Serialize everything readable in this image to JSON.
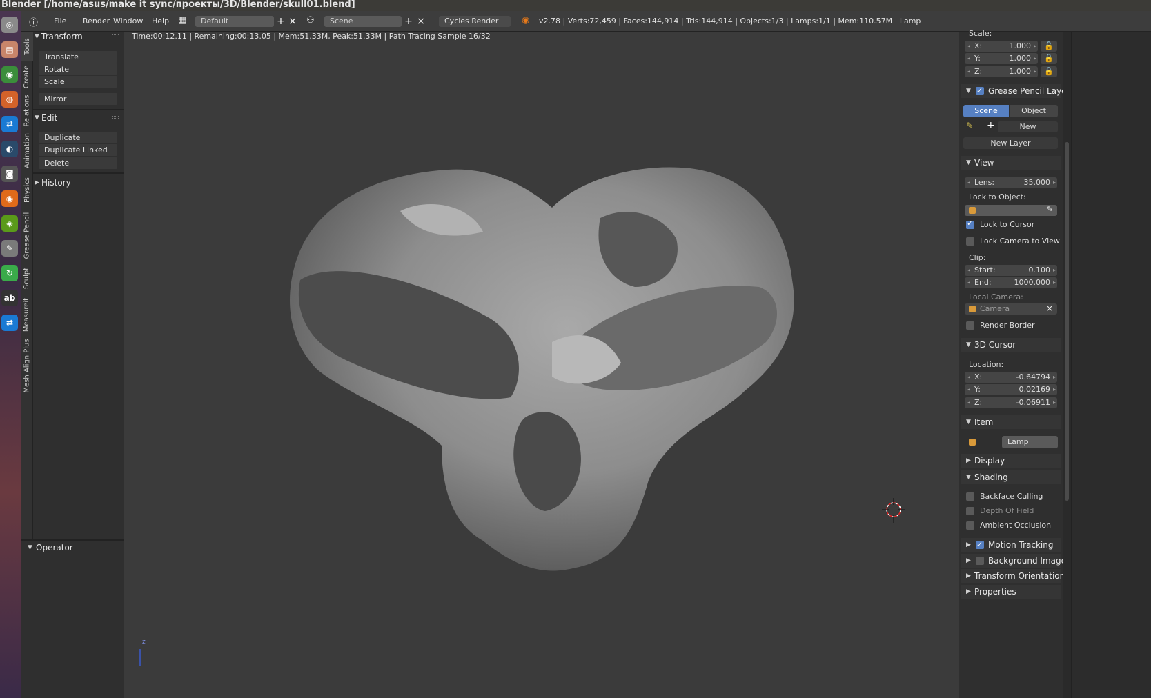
{
  "window": {
    "title": "Blender [/home/asus/make it sync/проекты/3D/Blender/skull01.blend]"
  },
  "colors": {
    "accent": "#5680c2",
    "panel": "#2f2f2f",
    "viewport": "#3b3b3b",
    "object_icon": "#d99a3a"
  },
  "launcher": {
    "icons": [
      {
        "name": "ubuntu-dash-icon",
        "glyph": "◎",
        "color": "#8a8a8a"
      },
      {
        "name": "files-icon",
        "glyph": "▤",
        "color": "#c8856a"
      },
      {
        "name": "chrome-icon",
        "glyph": "◉",
        "color": "#3b8d3b"
      },
      {
        "name": "firefox-icon",
        "glyph": "◍",
        "color": "#d4622a"
      },
      {
        "name": "teamviewer-icon",
        "glyph": "⇄",
        "color": "#1a7ad4"
      },
      {
        "name": "steam-icon",
        "glyph": "◐",
        "color": "#2a4a6a"
      },
      {
        "name": "camera-icon",
        "glyph": "◙",
        "color": "#555555"
      },
      {
        "name": "blender-icon",
        "glyph": "◉",
        "color": "#e06a1a"
      },
      {
        "name": "nvidia-icon",
        "glyph": "◈",
        "color": "#5a9a1a"
      },
      {
        "name": "text-editor-icon",
        "glyph": "✎",
        "color": "#7a7a7a"
      },
      {
        "name": "sync-icon",
        "glyph": "↻",
        "color": "#3aaa4a"
      },
      {
        "name": "dictionary-icon",
        "glyph": "ab",
        "color": "#333333"
      },
      {
        "name": "teamviewer-alt-icon",
        "glyph": "⇄",
        "color": "#1a7ad4"
      }
    ]
  },
  "header": {
    "menus": [
      "File",
      "Render",
      "Window",
      "Help"
    ],
    "layout": "Default",
    "scene": "Scene",
    "engine": "Cycles Render",
    "stats": "v2.78 | Verts:72,459 | Faces:144,914 | Tris:144,914 | Objects:1/3 | Lamps:1/1 | Mem:110.57M | Lamp"
  },
  "tool_tabs": [
    "Tools",
    "Create",
    "Relations",
    "Animation",
    "Physics",
    "Grease Pencil",
    "Sculpt",
    "Measureit",
    "Mesh Align Plus"
  ],
  "tool_panel": {
    "transform": {
      "title": "Transform",
      "buttons": [
        "Translate",
        "Rotate",
        "Scale",
        "Mirror"
      ]
    },
    "edit": {
      "title": "Edit",
      "buttons": [
        "Duplicate",
        "Duplicate Linked",
        "Delete"
      ]
    },
    "history": {
      "title": "History"
    },
    "operator": {
      "title": "Operator"
    }
  },
  "viewport": {
    "render_info": "Time:00:12.11 | Remaining:00:13.05 | Mem:51.33M, Peak:51.33M | Path Tracing Sample 16/32",
    "axis_label": "z"
  },
  "properties": {
    "scale": {
      "label": "Scale:",
      "x": "1.000",
      "y": "1.000",
      "z": "1.000"
    },
    "axis": {
      "x": "X:",
      "y": "Y:",
      "z": "Z:"
    },
    "grease_pencil": {
      "title": "Grease Pencil Layers",
      "tab_scene": "Scene",
      "tab_object": "Object",
      "new": "New",
      "new_layer": "New Layer"
    },
    "view": {
      "title": "View",
      "lens_label": "Lens:",
      "lens": "35.000",
      "lock_to_object": "Lock to Object:",
      "lock_to_cursor": "Lock to Cursor",
      "lock_camera": "Lock Camera to View",
      "clip": "Clip:",
      "start_label": "Start:",
      "start": "0.100",
      "end_label": "End:",
      "end": "1000.000",
      "local_camera": "Local Camera:",
      "camera": "Camera",
      "render_border": "Render Border"
    },
    "cursor": {
      "title": "3D Cursor",
      "location": "Location:",
      "x": "-0.64794",
      "y": "0.02169",
      "z": "-0.06911"
    },
    "item": {
      "title": "Item",
      "name": "Lamp"
    },
    "display": {
      "title": "Display"
    },
    "shading": {
      "title": "Shading",
      "backface": "Backface Culling",
      "dof": "Depth Of Field",
      "ao": "Ambient Occlusion"
    },
    "motion_tracking": {
      "title": "Motion Tracking"
    },
    "background_images": {
      "title": "Background Images"
    },
    "transform_orientations": {
      "title": "Transform Orientations"
    },
    "properties_panel": {
      "title": "Properties"
    }
  }
}
